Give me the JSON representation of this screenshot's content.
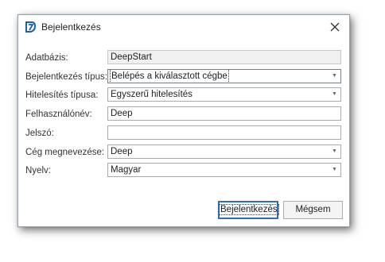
{
  "window": {
    "title": "Bejelentkezés",
    "app_icon": "deepstart-logo-icon",
    "close_icon": "close-icon"
  },
  "form": {
    "database_label": "Adatbázis:",
    "database_value": "DeepStart",
    "login_type_label": "Bejelentkezés típus:",
    "login_type_value": "Belépés a kiválasztott cégbe",
    "auth_type_label": "Hitelesítés típusa:",
    "auth_type_value": "Egyszerű hitelesítés",
    "username_label": "Felhasználónév:",
    "username_value": "Deep",
    "password_label": "Jelszó:",
    "password_value": "",
    "company_label": "Cég megnevezése:",
    "company_value": "Deep",
    "language_label": "Nyelv:",
    "language_value": "Magyar",
    "dropdown_icon": "chevron-down-icon"
  },
  "buttons": {
    "login_label": "Bejelentkezés",
    "cancel_label": "Mégsem"
  },
  "colors": {
    "accent": "#2d6fb4",
    "logo": "#1b5fa8"
  }
}
